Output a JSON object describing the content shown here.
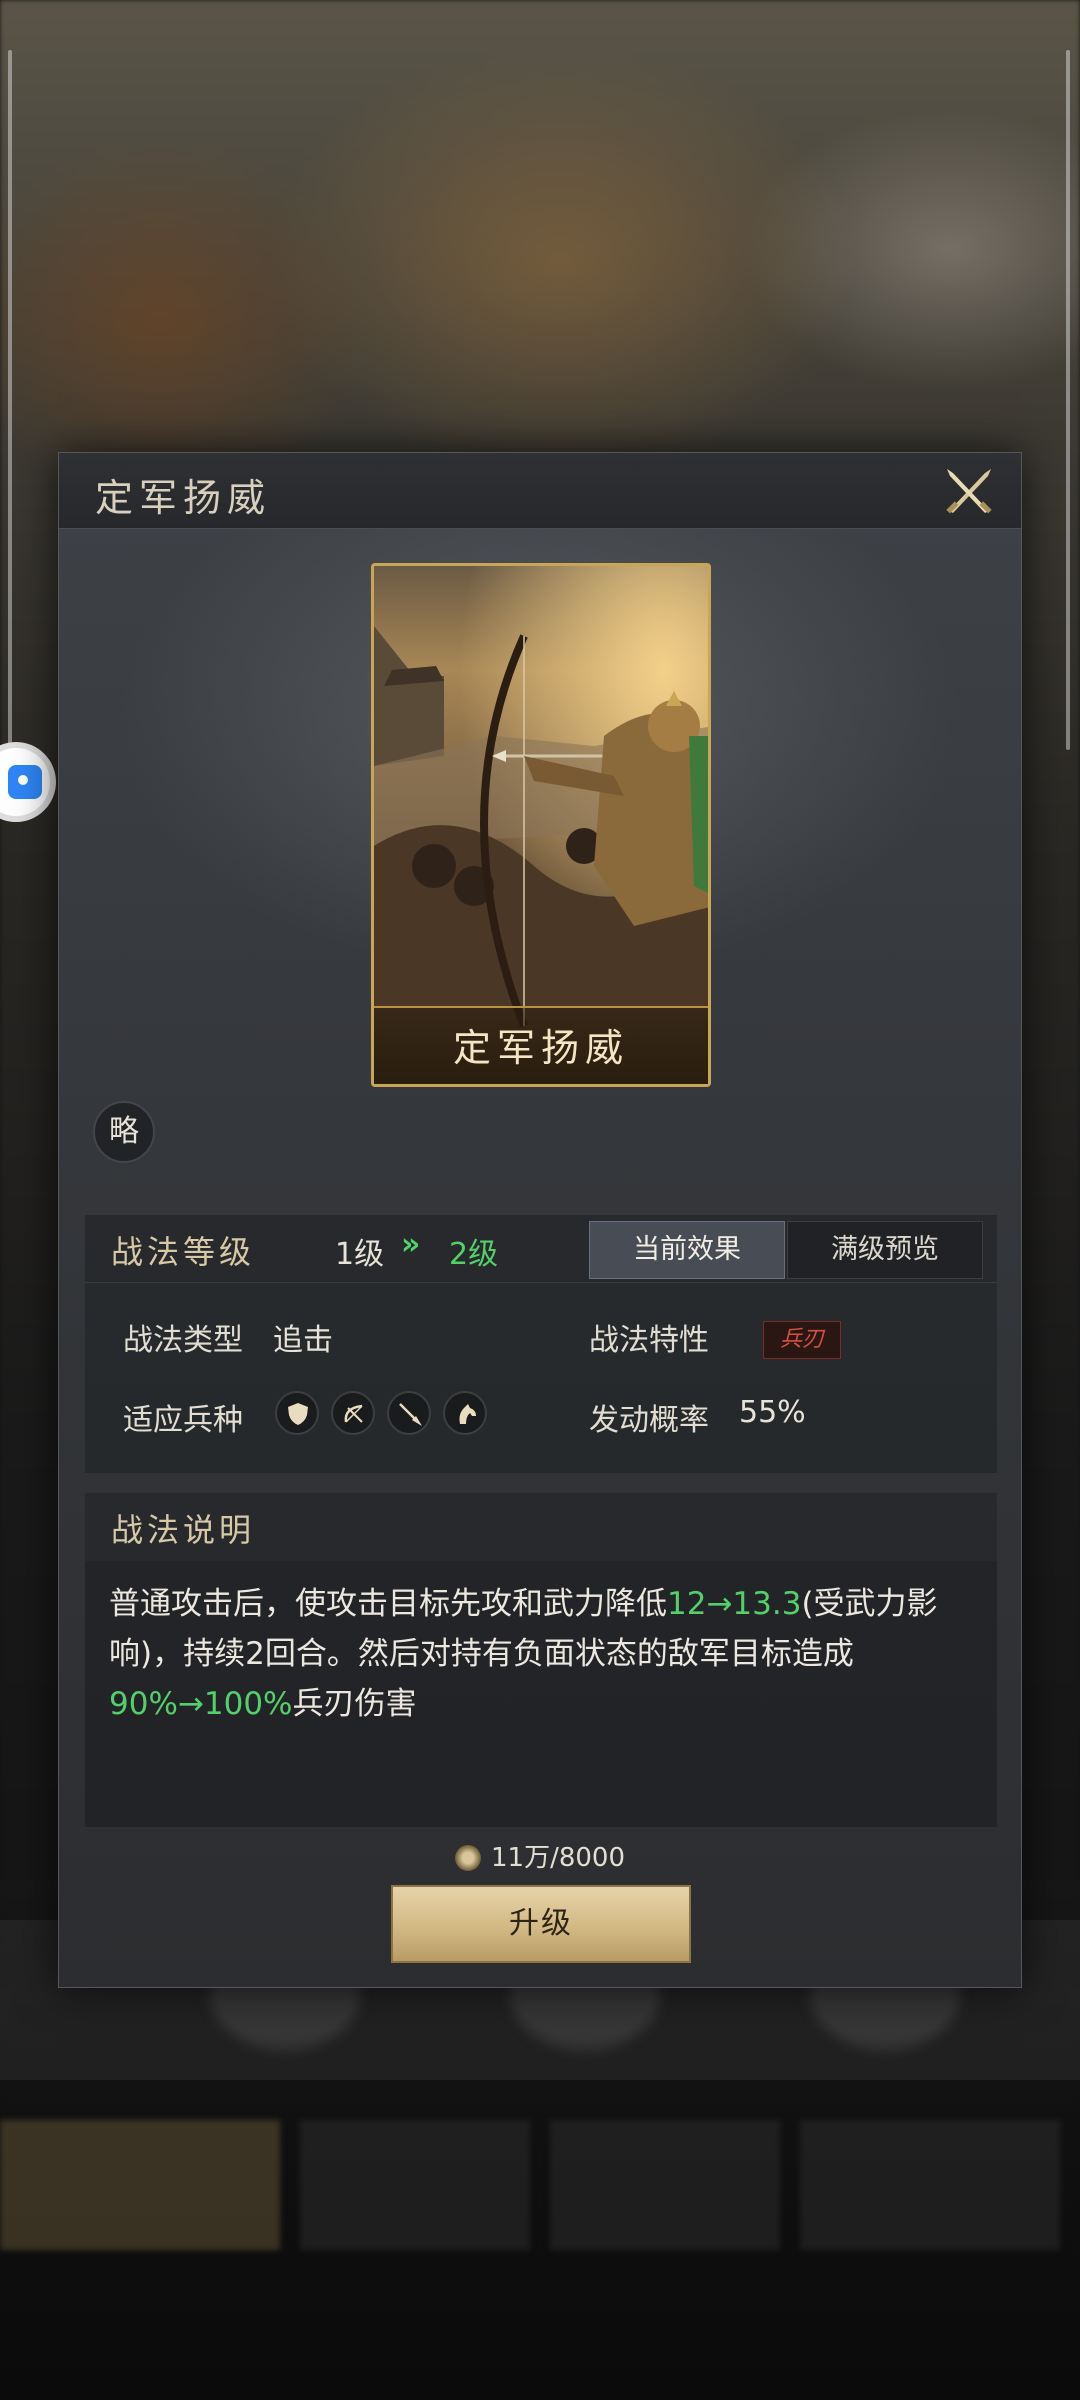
{
  "dialog": {
    "title": "定军扬威",
    "close_icon": "close-swords-icon"
  },
  "card": {
    "label": "定军扬威",
    "image": "archer-card-art"
  },
  "badge": {
    "text": "略"
  },
  "level": {
    "label": "战法等级",
    "current": "1级",
    "arrow": "»",
    "next": "2级",
    "tabs": [
      {
        "label": "当前效果",
        "active": true
      },
      {
        "label": "满级预览",
        "active": false
      }
    ]
  },
  "attributes": {
    "type_label": "战法类型",
    "type_value": "追击",
    "feature_label": "战法特性",
    "feature_tag": "兵刃",
    "troops_label": "适应兵种",
    "troop_icons": [
      "shield-icon",
      "bow-icon",
      "spear-icon",
      "horse-icon"
    ],
    "rate_label": "发动概率",
    "rate_value": "55%"
  },
  "description": {
    "title": "战法说明",
    "text_1": "普通攻击后，使攻击目标先攻和武力降低",
    "hl_1": "12→13.3",
    "text_2": "(受武力影响)，持续2回合。然后对持有负面状态的敌军目标造成",
    "hl_2": "90%→100%",
    "text_3": "兵刃伤害"
  },
  "cost": {
    "icon": "coin-icon",
    "value": "11万/8000"
  },
  "upgrade_button": {
    "label": "升级"
  },
  "colors": {
    "highlight_green": "#53d06a",
    "gold": "#c9a556",
    "tag_red": "#d5503f"
  }
}
